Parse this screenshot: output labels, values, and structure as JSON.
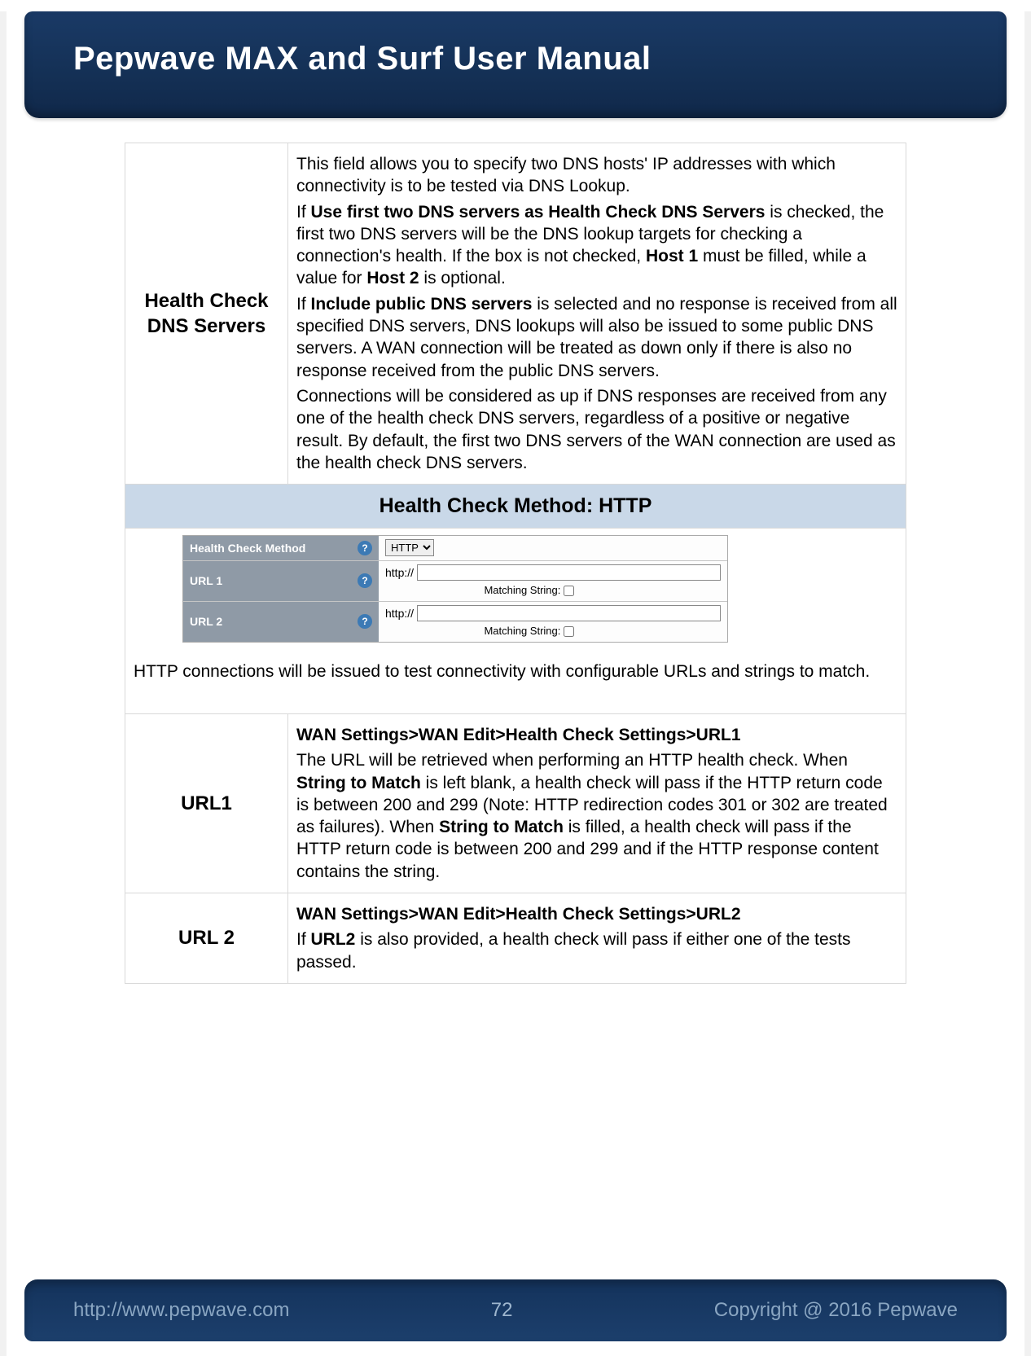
{
  "header": {
    "title": "Pepwave MAX and Surf User Manual"
  },
  "rows": {
    "dns": {
      "label": "Health Check DNS Servers",
      "p1": "This field allows you to specify two DNS hosts' IP addresses with which connectivity is to be tested via DNS Lookup.",
      "p2a": "If ",
      "p2b": "Use first two DNS servers as Health Check DNS Servers",
      "p2c": " is checked, the first two DNS servers will be the DNS lookup targets for checking a connection's health. If the box is not checked, ",
      "p2d": "Host 1",
      "p2e": " must be filled, while a value for ",
      "p2f": "Host 2",
      "p2g": " is optional.",
      "p3a": "If ",
      "p3b": "Include public DNS servers",
      "p3c": " is selected and no response is received from all specified DNS servers, DNS lookups will also be issued to some public DNS servers. A WAN connection will be treated as down only if there is also no response received from the public DNS servers.",
      "p4": "Connections will be considered as up if DNS responses are received from any one of the health check DNS servers, regardless of a positive or negative result. By default, the first two DNS servers of the WAN connection are used as the health check DNS servers."
    },
    "section_http": "Health Check Method: HTTP",
    "embedded": {
      "method_label": "Health Check Method",
      "method_value": "HTTP",
      "url1_label": "URL 1",
      "url2_label": "URL 2",
      "prefix": "http://",
      "match": "Matching String:",
      "help": "?"
    },
    "http_note": "HTTP connections will be issued to test connectivity with configurable URLs and strings to match.",
    "url1": {
      "label": "URL1",
      "bc": "WAN Settings>WAN Edit>Health Check Settings>URL1",
      "t1": "The URL will be retrieved when performing an HTTP health check. When ",
      "t2": "String to Match",
      "t3": " is left blank, a health check will pass if the HTTP return code is between 200 and 299 (Note: HTTP redirection codes 301 or 302 are treated as failures). When ",
      "t4": "String to Match",
      "t5": " is filled, a health check will pass if the HTTP return code is between 200 and 299 and if the HTTP response content contains the string."
    },
    "url2": {
      "label": "URL 2",
      "bc": "WAN Settings>WAN Edit>Health Check Settings>URL2",
      "t1": "If ",
      "t2": "URL2",
      "t3": " is also provided, a health check will pass if either one of the tests passed."
    }
  },
  "footer": {
    "url": "http://www.pepwave.com",
    "page": "72",
    "copyright": "Copyright @ 2016 Pepwave"
  }
}
